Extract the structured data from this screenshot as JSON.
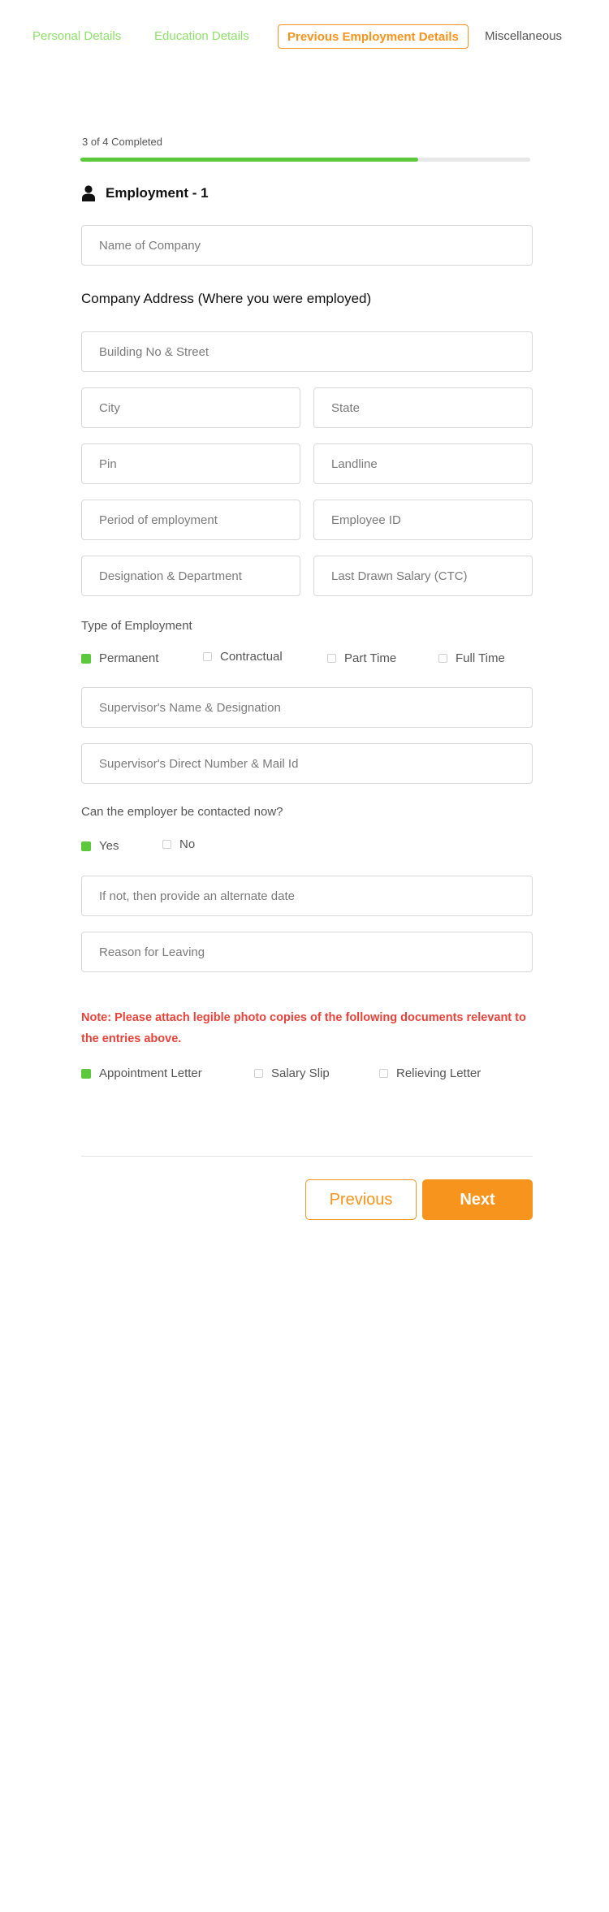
{
  "tabs": [
    {
      "label": "Personal Details",
      "state": "done"
    },
    {
      "label": "Education Details",
      "state": "done"
    },
    {
      "label": "Previous Employment Details",
      "state": "active"
    },
    {
      "label": "Miscellaneous",
      "state": "todo"
    }
  ],
  "progress": {
    "label": "3 of 4 Completed",
    "completed": 3,
    "total": 4
  },
  "section": {
    "title": "Employment - 1",
    "icon": "user-icon"
  },
  "fields": {
    "company_name": "Name of Company",
    "building": "Building No & Street",
    "city": "City",
    "state": "State",
    "pin": "Pin",
    "landline": "Landline",
    "period": "Period of employment",
    "employee_id": "Employee ID",
    "designation": "Designation & Department",
    "salary": "Last Drawn Salary (CTC)",
    "supervisor_name": "Supervisor's Name & Designation",
    "supervisor_contact": "Supervisor's Direct Number & Mail Id",
    "alternate_date": "If not, then provide an alternate date",
    "reason": "Reason for Leaving"
  },
  "address_heading": "Company Address (Where you were employed)",
  "employment_type": {
    "label": "Type of Employment",
    "options": [
      {
        "label": "Permanent",
        "checked": true
      },
      {
        "label": "Contractual",
        "checked": false
      },
      {
        "label": "Part Time",
        "checked": false
      },
      {
        "label": "Full Time",
        "checked": false
      }
    ]
  },
  "contact_question": {
    "label": "Can the employer be contacted now?",
    "options": [
      {
        "label": "Yes",
        "checked": true
      },
      {
        "label": "No",
        "checked": false
      }
    ]
  },
  "note": "Note: Please attach legible photo copies of the following documents relevant to the entries above.",
  "documents": [
    {
      "label": "Appointment Letter",
      "checked": true
    },
    {
      "label": "Salary Slip",
      "checked": false
    },
    {
      "label": "Relieving Letter",
      "checked": false
    }
  ],
  "buttons": {
    "previous": "Previous",
    "next": "Next"
  },
  "colors": {
    "accent": "#f7941d",
    "success": "#5cc93d",
    "done_tab": "#8fe06b",
    "note": "#e8433b"
  }
}
